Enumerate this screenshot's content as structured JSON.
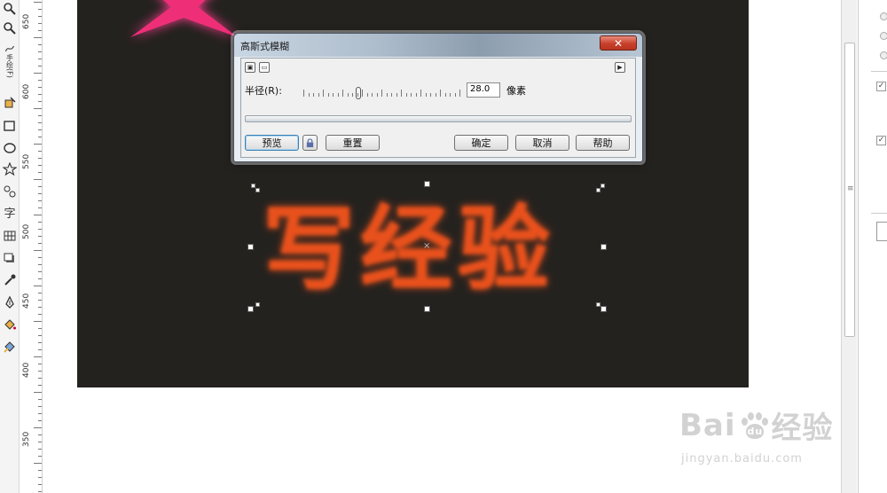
{
  "toolbox": {
    "items": [
      {
        "name": "zoom-tool",
        "glyph": "⌕"
      },
      {
        "name": "freehand-tool",
        "glyph": "手绘(F)"
      },
      {
        "name": "smart-fill-tool",
        "glyph": "⬙"
      },
      {
        "name": "rectangle-tool",
        "glyph": "□"
      },
      {
        "name": "ellipse-tool",
        "glyph": "○"
      },
      {
        "name": "star-tool",
        "glyph": "☆"
      },
      {
        "name": "basic-shapes-tool",
        "glyph": "⚇"
      },
      {
        "name": "text-tool",
        "glyph": "字"
      },
      {
        "name": "table-tool",
        "glyph": "▦"
      },
      {
        "name": "shadow-tool",
        "glyph": "◳"
      },
      {
        "name": "eyedropper-tool",
        "glyph": "⁄"
      },
      {
        "name": "outline-pen-tool",
        "glyph": "✒"
      },
      {
        "name": "fill-tool",
        "glyph": "⬖"
      },
      {
        "name": "interactive-fill-tool",
        "glyph": "⬘"
      }
    ]
  },
  "ruler": {
    "labels": [
      "650",
      "600",
      "550",
      "500",
      "450",
      "400",
      "350"
    ]
  },
  "canvas": {
    "page_color": "#24221f",
    "star_color": "#ff3d8d",
    "blurred_text": "写经验",
    "blurred_text_color": "#e9511c"
  },
  "dialog": {
    "title": "高斯式模糊",
    "close_glyph": "✕",
    "radius_label": "半径(R):",
    "radius_value": "28.0",
    "radius_unit": "像素",
    "radius_fraction": 0.35,
    "preview_label": "预览",
    "reset_label": "重置",
    "ok_label": "确定",
    "cancel_label": "取消",
    "help_label": "帮助"
  },
  "watermark": {
    "brand_left": "Bai",
    "brand_right": "经验",
    "brand_du": "du",
    "url": "jingyan.baidu.com"
  }
}
